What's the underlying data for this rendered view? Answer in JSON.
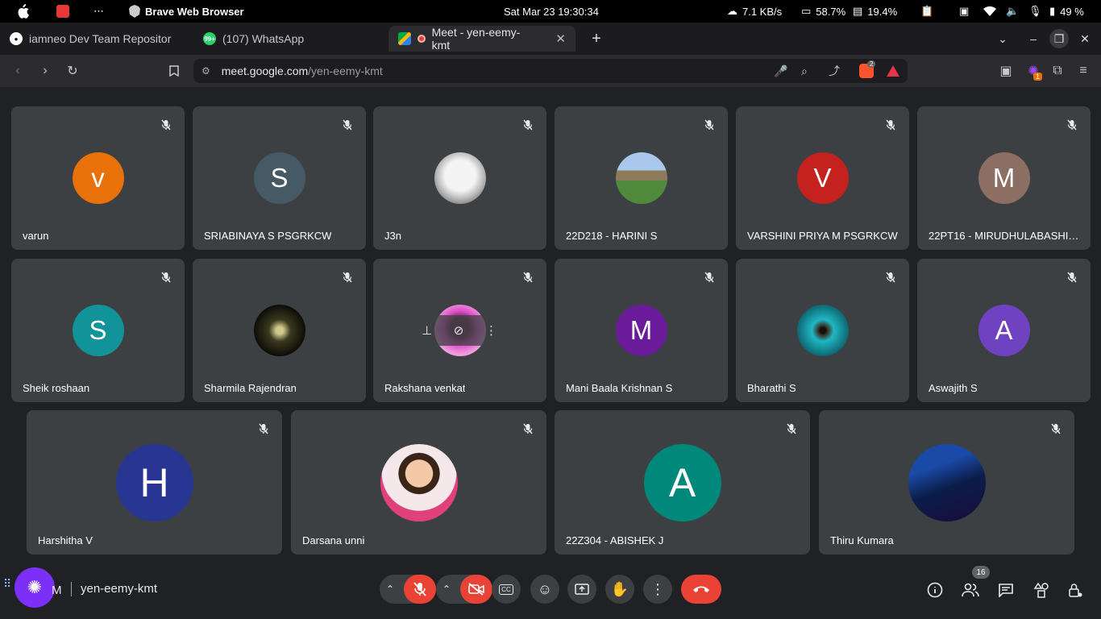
{
  "os": {
    "app_name": "Brave Web Browser",
    "datetime": "Sat Mar 23  19:30:34",
    "net_speed": "7.1 KB/s",
    "cpu": "58.7%",
    "mem": "19.4%",
    "battery": "49 %"
  },
  "tabs": [
    {
      "label": "iamneo Dev Team Repositor",
      "icon": "github-icon"
    },
    {
      "label": "(107) WhatsApp",
      "icon": "whatsapp-icon",
      "badge": "99+"
    },
    {
      "label": "Meet - yen-eemy-kmt",
      "icon": "meet-icon",
      "active": true
    }
  ],
  "url": {
    "host": "meet.google.com",
    "path": "/yen-eemy-kmt"
  },
  "extensions": {
    "brave_count": "2",
    "ext_count": "1"
  },
  "participants": [
    {
      "name": "varun",
      "initial": "v",
      "color": "#e8710a",
      "kind": "letter"
    },
    {
      "name": "SRIABINAYA S PSGRKCW",
      "initial": "S",
      "color": "#455a64",
      "kind": "letter"
    },
    {
      "name": "J3n",
      "initial": "",
      "color": "#d8d8d8",
      "kind": "photo-cat"
    },
    {
      "name": "22D218 - HARINI S",
      "initial": "",
      "color": "#6f9a62",
      "kind": "photo-landscape"
    },
    {
      "name": "VARSHINI PRIYA M PSGRKCW",
      "initial": "V",
      "color": "#c5221f",
      "kind": "letter"
    },
    {
      "name": "22PT16 - MIRUDHULABASHIN...",
      "initial": "M",
      "color": "#8d6e63",
      "kind": "letter"
    },
    {
      "name": "Sheik roshaan",
      "initial": "S",
      "color": "#12939a",
      "kind": "letter"
    },
    {
      "name": "Sharmila Rajendran",
      "initial": "",
      "color": "#1a1a12",
      "kind": "photo-dark"
    },
    {
      "name": "Rakshana venkat",
      "initial": "",
      "color": "#c43bb8",
      "kind": "photo-pink"
    },
    {
      "name": "Mani Baala Krishnan S",
      "initial": "M",
      "color": "#6a1b9a",
      "kind": "letter"
    },
    {
      "name": "Bharathi S",
      "initial": "",
      "color": "#1a8a96",
      "kind": "photo-teal"
    },
    {
      "name": "Aswajith S",
      "initial": "A",
      "color": "#6f42c1",
      "kind": "letter"
    },
    {
      "name": "Harshitha V",
      "initial": "H",
      "color": "#283593",
      "kind": "letter"
    },
    {
      "name": "Darsana unni",
      "initial": "",
      "color": "#f3e6e8",
      "kind": "photo-cartoon"
    },
    {
      "name": "22Z304 - ABISHEK J",
      "initial": "A",
      "color": "#00897b",
      "kind": "letter"
    },
    {
      "name": "Thiru Kumara",
      "initial": "",
      "color": "#0e2a5c",
      "kind": "photo-hero"
    }
  ],
  "meeting": {
    "code": "yen-eemy-kmt",
    "self_initial": "M",
    "participant_count": "16"
  },
  "colors": {
    "bg": "#202124",
    "tile": "#3c4043",
    "danger": "#ea4335",
    "brave_orange": "#fb542b"
  }
}
